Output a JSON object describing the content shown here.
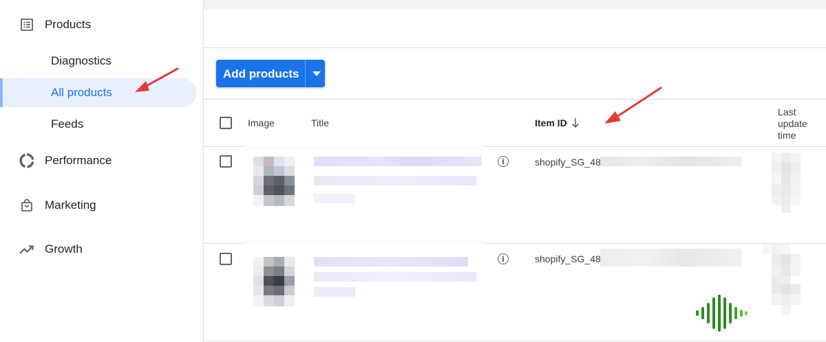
{
  "sidebar": {
    "products": "Products",
    "diagnostics": "Diagnostics",
    "all_products": "All products",
    "feeds": "Feeds",
    "performance": "Performance",
    "marketing": "Marketing",
    "growth": "Growth"
  },
  "toolbar": {
    "add_products": "Add products"
  },
  "table": {
    "headers": {
      "image": "Image",
      "title": "Title",
      "item_id": "Item ID",
      "last_update_time": "Last update time"
    },
    "rows": [
      {
        "item_id": "shopify_SG_48"
      },
      {
        "item_id": "shopify_SG_48"
      }
    ]
  },
  "icons": {
    "products": "list-icon",
    "performance": "donut-chart-icon",
    "marketing": "shopping-bag-icon",
    "growth": "trending-up-icon",
    "sort": "arrow-down-icon",
    "info": "info-icon",
    "audio_logo": "sound-wave-icon"
  },
  "colors": {
    "accent": "#1a73e8",
    "active_nav_bg": "#e8f0fe",
    "annotation_arrow": "#e53935",
    "logo_green": "#2e8b22"
  }
}
